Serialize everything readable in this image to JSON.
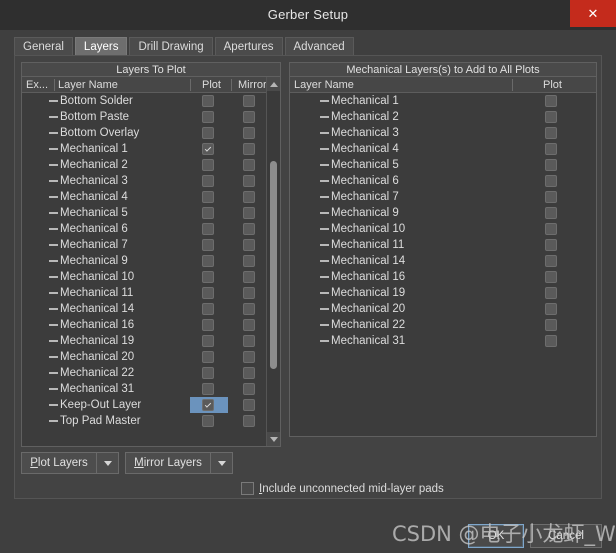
{
  "window": {
    "title": "Gerber Setup",
    "close_label": "✕"
  },
  "tabs": [
    {
      "label": "General",
      "active": false
    },
    {
      "label": "Layers",
      "active": true
    },
    {
      "label": "Drill Drawing",
      "active": false
    },
    {
      "label": "Apertures",
      "active": false
    },
    {
      "label": "Advanced",
      "active": false
    }
  ],
  "left_panel": {
    "title": "Layers To Plot",
    "columns": [
      "Ex...",
      "Layer Name",
      "Plot",
      "Mirror"
    ],
    "rows": [
      {
        "name": "Bottom Solder",
        "plot": false,
        "mirror": false,
        "selected": false
      },
      {
        "name": "Bottom Paste",
        "plot": false,
        "mirror": false,
        "selected": false
      },
      {
        "name": "Bottom Overlay",
        "plot": false,
        "mirror": false,
        "selected": false
      },
      {
        "name": "Mechanical 1",
        "plot": true,
        "mirror": false,
        "selected": false
      },
      {
        "name": "Mechanical 2",
        "plot": false,
        "mirror": false,
        "selected": false
      },
      {
        "name": "Mechanical 3",
        "plot": false,
        "mirror": false,
        "selected": false
      },
      {
        "name": "Mechanical 4",
        "plot": false,
        "mirror": false,
        "selected": false
      },
      {
        "name": "Mechanical 5",
        "plot": false,
        "mirror": false,
        "selected": false
      },
      {
        "name": "Mechanical 6",
        "plot": false,
        "mirror": false,
        "selected": false
      },
      {
        "name": "Mechanical 7",
        "plot": false,
        "mirror": false,
        "selected": false
      },
      {
        "name": "Mechanical 9",
        "plot": false,
        "mirror": false,
        "selected": false
      },
      {
        "name": "Mechanical 10",
        "plot": false,
        "mirror": false,
        "selected": false
      },
      {
        "name": "Mechanical 11",
        "plot": false,
        "mirror": false,
        "selected": false
      },
      {
        "name": "Mechanical 14",
        "plot": false,
        "mirror": false,
        "selected": false
      },
      {
        "name": "Mechanical 16",
        "plot": false,
        "mirror": false,
        "selected": false
      },
      {
        "name": "Mechanical 19",
        "plot": false,
        "mirror": false,
        "selected": false
      },
      {
        "name": "Mechanical 20",
        "plot": false,
        "mirror": false,
        "selected": false
      },
      {
        "name": "Mechanical 22",
        "plot": false,
        "mirror": false,
        "selected": false
      },
      {
        "name": "Mechanical 31",
        "plot": false,
        "mirror": false,
        "selected": false
      },
      {
        "name": "Keep-Out Layer",
        "plot": true,
        "mirror": false,
        "selected": true
      },
      {
        "name": "Top Pad Master",
        "plot": false,
        "mirror": false,
        "selected": false
      }
    ],
    "scrollbar": {
      "up_icon": "chevron-up-icon",
      "down_icon": "chevron-down-icon"
    }
  },
  "right_panel": {
    "title": "Mechanical Layers(s) to Add to All Plots",
    "columns": [
      "Layer Name",
      "Plot"
    ],
    "rows": [
      {
        "name": "Mechanical 1",
        "plot": false
      },
      {
        "name": "Mechanical 2",
        "plot": false
      },
      {
        "name": "Mechanical 3",
        "plot": false
      },
      {
        "name": "Mechanical 4",
        "plot": false
      },
      {
        "name": "Mechanical 5",
        "plot": false
      },
      {
        "name": "Mechanical 6",
        "plot": false
      },
      {
        "name": "Mechanical 7",
        "plot": false
      },
      {
        "name": "Mechanical 9",
        "plot": false
      },
      {
        "name": "Mechanical 10",
        "plot": false
      },
      {
        "name": "Mechanical 11",
        "plot": false
      },
      {
        "name": "Mechanical 14",
        "plot": false
      },
      {
        "name": "Mechanical 16",
        "plot": false
      },
      {
        "name": "Mechanical 19",
        "plot": false
      },
      {
        "name": "Mechanical 20",
        "plot": false
      },
      {
        "name": "Mechanical 22",
        "plot": false
      },
      {
        "name": "Mechanical 31",
        "plot": false
      }
    ]
  },
  "bottom": {
    "plot_layers": {
      "accel": "P",
      "rest": "lot Layers"
    },
    "mirror_layers": {
      "accel": "M",
      "rest": "irror Layers"
    },
    "include_pads": {
      "accel": "I",
      "rest": "nclude unconnected mid-layer pads",
      "checked": false
    }
  },
  "footer": {
    "ok_label": "OK",
    "cancel_label": "Cancel"
  },
  "watermark": {
    "text": "CSDN @电子小龙虾_W超"
  },
  "colors": {
    "window_bg": "#3f3f3f",
    "titlebar_bg": "#2f2f2f",
    "close_red": "#c42b1c",
    "selection_blue": "#6b93bd",
    "panel_bg": "#3c3c3c",
    "text": "#dcdcdc"
  }
}
